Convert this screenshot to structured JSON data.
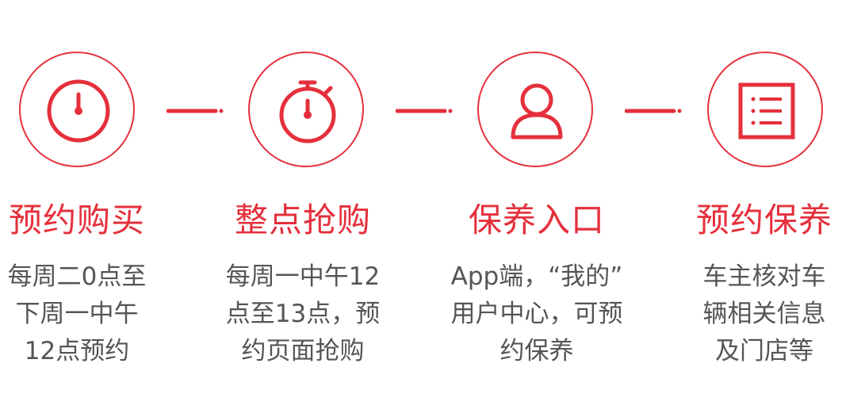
{
  "colors": {
    "accent": "#e5303c",
    "text": "#555555"
  },
  "steps": [
    {
      "icon": "clock-icon",
      "title": "预约购买",
      "desc": [
        "每周二0点至",
        "下周一中午",
        "12点预约"
      ]
    },
    {
      "icon": "stopwatch-icon",
      "title": "整点抢购",
      "desc": [
        "每周一中午12",
        "点至13点，预",
        "约页面抢购"
      ]
    },
    {
      "icon": "user-icon",
      "title": "保养入口",
      "desc": [
        "App端，“我的”",
        "用户中心，可预",
        "约保养"
      ]
    },
    {
      "icon": "list-icon",
      "title": "预约保养",
      "desc": [
        "车主核对车",
        "辆相关信息",
        "及门店等"
      ]
    }
  ]
}
